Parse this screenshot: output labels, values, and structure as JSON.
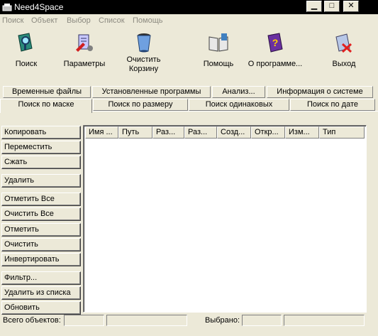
{
  "window": {
    "title": "Need4Space"
  },
  "menu": [
    "Поиск",
    "Объект",
    "Выбор",
    "Список",
    "Помощь"
  ],
  "toolbar": {
    "search": "Поиск",
    "settings": "Параметры",
    "clear_bin": "Очистить\nКорзину",
    "help": "Помощь",
    "about": "О программе...",
    "exit": "Выход"
  },
  "tabs_top": [
    "Временные файлы",
    "Установленные программы",
    "Анализ...",
    "Информация о системе"
  ],
  "tabs_bottom": [
    "Поиск по маске",
    "Поиск по размеру",
    "Поиск одинаковых",
    "Поиск по дате"
  ],
  "active_tab": "Поиск по маске",
  "buttons": [
    "Копировать",
    "Переместить",
    "Сжать",
    "Удалить",
    "Отметить Все",
    "Очистить Все",
    "Отметить",
    "Очистить",
    "Инвертировать",
    "Фильтр...",
    "Удалить из списка",
    "Обновить"
  ],
  "columns": [
    "Имя ...",
    "Путь",
    "Раз...",
    "Раз...",
    "Созд...",
    "Откр...",
    "Изм...",
    "Тип"
  ],
  "rows": [],
  "status": {
    "total_label": "Всего объектов:",
    "total_value": "",
    "selected_label": "Выбрано:",
    "selected_value": ""
  }
}
